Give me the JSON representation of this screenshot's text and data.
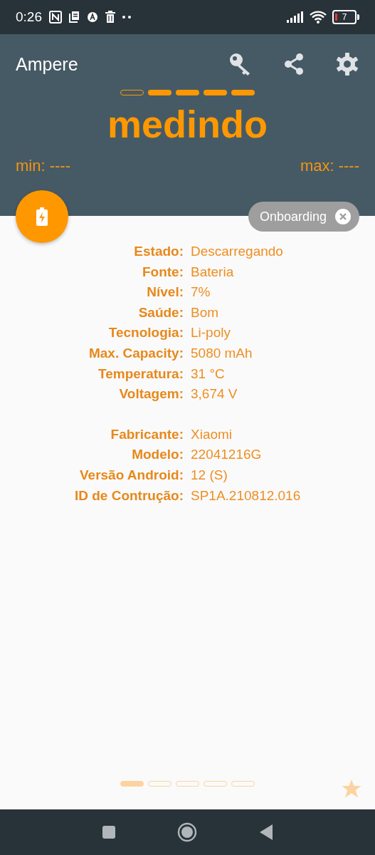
{
  "status_bar": {
    "time": "0:26",
    "battery": "7"
  },
  "app_bar": {
    "title": "Ampere"
  },
  "meter": {
    "segments": [
      {
        "filled": false
      },
      {
        "filled": true
      },
      {
        "filled": true
      },
      {
        "filled": true
      },
      {
        "filled": true
      }
    ],
    "status": "medindo",
    "min": "min: ----",
    "max": "max: ----"
  },
  "chip": {
    "label": "Onboarding"
  },
  "info_groups": [
    [
      {
        "label": "Estado:",
        "value": "Descarregando"
      },
      {
        "label": "Fonte:",
        "value": "Bateria"
      },
      {
        "label": "Nível:",
        "value": "7%"
      },
      {
        "label": "Saúde:",
        "value": "Bom"
      },
      {
        "label": "Tecnologia:",
        "value": "Li-poly"
      },
      {
        "label": "Max. Capacity:",
        "value": "5080 mAh"
      },
      {
        "label": "Temperatura:",
        "value": "31 °C"
      },
      {
        "label": "Voltagem:",
        "value": "3,674 V"
      }
    ],
    [
      {
        "label": "Fabricante:",
        "value": "Xiaomi"
      },
      {
        "label": "Modelo:",
        "value": "22041216G"
      },
      {
        "label": "Versão Android:",
        "value": "12 (S)"
      },
      {
        "label": "ID de Contrução:",
        "value": "SP1A.210812.016"
      }
    ]
  ],
  "pages": [
    {
      "selected": true
    },
    {
      "selected": false
    },
    {
      "selected": false
    },
    {
      "selected": false
    },
    {
      "selected": false
    }
  ]
}
